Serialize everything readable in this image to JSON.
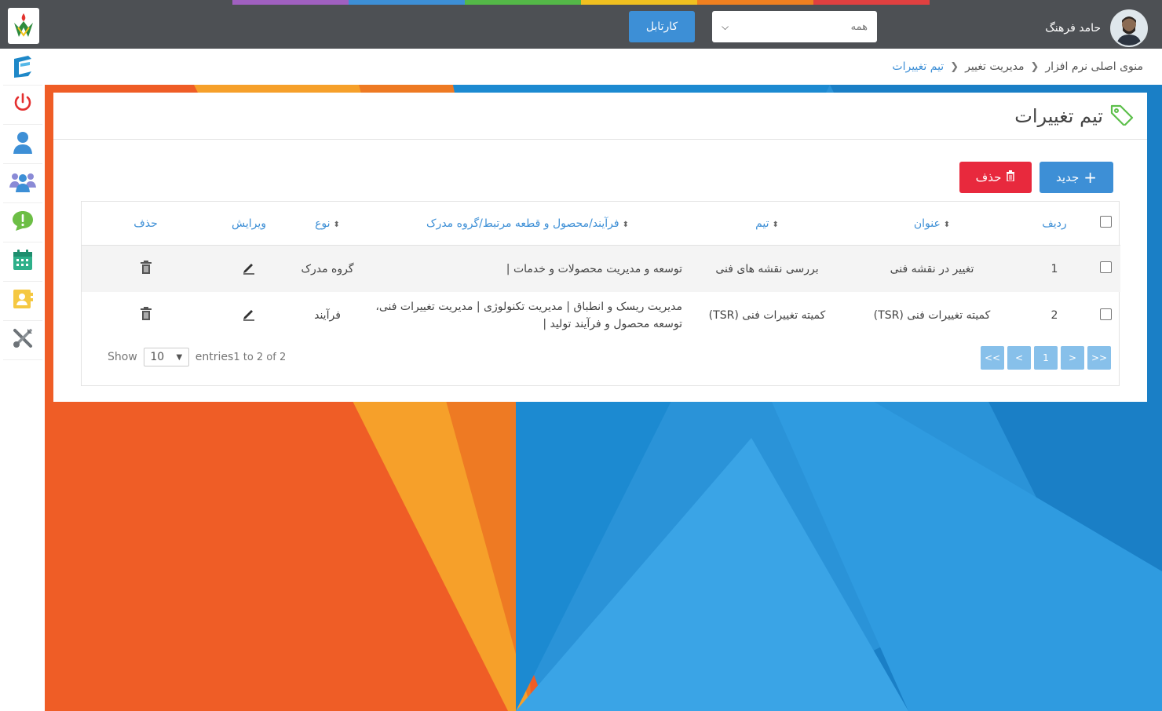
{
  "topbar": {
    "user_name": "حامد فرهنگ",
    "select_value": "همه",
    "cartable_label": "کارتابل",
    "stripe_colors": [
      "#4d5054",
      "#4d5054",
      "#a060c0",
      "#3d8fd6",
      "#54b848",
      "#f0c020",
      "#f08020",
      "#e04040",
      "#4d5054",
      "#4d5054"
    ]
  },
  "breadcrumb": {
    "items": [
      "منوی اصلی نرم افزار",
      "مدیریت تغییر",
      "تیم تغییرات"
    ]
  },
  "panel": {
    "title": "تیم تغییرات",
    "new_button": "جدید",
    "delete_button": "حذف"
  },
  "table": {
    "headers": [
      "ردیف",
      "عنوان",
      "تیم",
      "فرآیند/محصول و قطعه مرتبط/گروه مدرک",
      "نوع",
      "ویرایش",
      "حذف"
    ],
    "rows": [
      {
        "index": "1",
        "title": "تغییر در نقشه فنی",
        "team": "بررسی نقشه های فنی",
        "related": "توسعه و مدیریت محصولات و خدمات |",
        "type": "گروه مدرک"
      },
      {
        "index": "2",
        "title": "کمیته تغییرات فنی (TSR)",
        "team": "کمیته تغییرات فنی (TSR)",
        "related": "مدیریت ریسک و انطباق | مدیریت تکنولوژی | مدیریت تغییرات فنی، توسعه محصول و فرآیند تولید |",
        "type": "فرآیند"
      }
    ],
    "show_label": "Show",
    "page_size": "10",
    "entries_label": "entries",
    "info": "1 to 2 of 2",
    "pager": [
      "<<",
      "<",
      "1",
      ">",
      ">>"
    ]
  },
  "colors": {
    "primary": "#3d8fd6",
    "danger": "#e8293d",
    "topbar": "#4d5054"
  }
}
